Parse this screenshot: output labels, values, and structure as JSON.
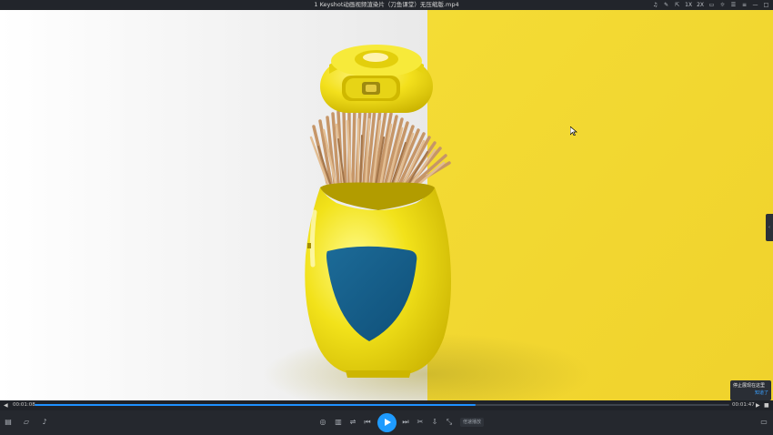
{
  "window": {
    "title": "1 Keyshot动画视频渲染片（刀鱼课堂）无压缩版.mp4"
  },
  "titlebar_icons": [
    {
      "name": "bell-icon",
      "glyph": "♫"
    },
    {
      "name": "tools-icon",
      "glyph": "✎"
    },
    {
      "name": "export-icon",
      "glyph": "⇱"
    },
    {
      "name": "speed-1x",
      "label": "1X"
    },
    {
      "name": "speed-2x",
      "label": "2X"
    },
    {
      "name": "screen-icon",
      "glyph": "▭"
    },
    {
      "name": "bulb-icon",
      "glyph": "☼"
    },
    {
      "name": "menu-icon",
      "glyph": "☰"
    },
    {
      "name": "list-icon",
      "glyph": "≡"
    },
    {
      "name": "minimize-icon",
      "glyph": "—"
    },
    {
      "name": "maximize-icon",
      "glyph": "□"
    }
  ],
  "player": {
    "current_time": "00:01:08",
    "total_time": "00:01:47",
    "progress_fraction": 0.635,
    "buffer_fraction": 0.62,
    "speed_button": "倍速播放"
  },
  "toast": {
    "message": "停止展现在这里",
    "action": "知道了"
  },
  "colors": {
    "accent": "#1e9bff",
    "video_yellow": "#f5dc34",
    "product_yellow": "#f2de18",
    "shield_blue": "#17618e"
  }
}
